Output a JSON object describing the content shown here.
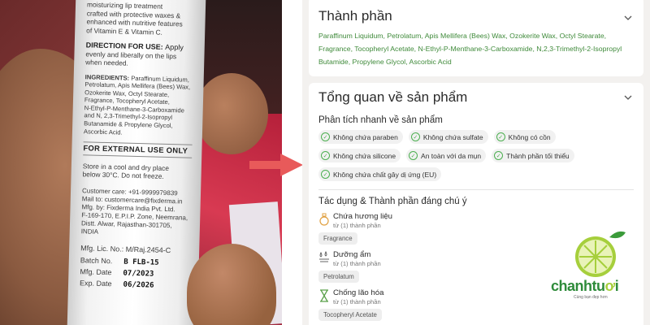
{
  "photo": {
    "intro_lines": [
      "moisturizing lip treatment",
      "crafted with protective waxes &",
      "enhanced with nutritive features",
      "of Vitamin E & Vitamin C."
    ],
    "direction_heading": "DIRECTION FOR USE:",
    "direction_lines": [
      "Apply",
      "evenly and liberally on the lips",
      "when needed."
    ],
    "ingredients_heading": "INGREDIENTS:",
    "ingredients_lines": [
      "Paraffinum Liquidum,",
      "Petrolatum, Apis Mellifera (Bees) Wax,",
      "Ozokerite Wax, Octyl Stearate,",
      "Fragrance, Tocopheryl Acetate,",
      "N-Ethyl-P-Menthane-3-Carboxamide",
      "and N, 2,3-Trimethyl-2-Isopropyl",
      "Butanamide & Propylene Glycol,",
      "Ascorbic Acid."
    ],
    "external_use": "FOR EXTERNAL USE ONLY",
    "store_lines": [
      "Store in a cool and dry place",
      "below 30°C. Do not freeze."
    ],
    "care_lines": [
      "Customer care: +91-9999979839",
      "Mail to: customercare@fixderma.in",
      "Mfg. by: Fixderma India Pvt. Ltd.",
      "F-169-170, E.P.I.P. Zone, Neemrana,",
      "Distt. Alwar, Rajasthan-301705,",
      "INDIA"
    ],
    "license": "Mfg. Lic. No.: M/Raj.2454-C",
    "batch_label": "Batch No.",
    "batch_value": "B FLB-15",
    "mfg_label": "Mfg. Date",
    "mfg_value": "07/2023",
    "exp_label": "Exp. Date",
    "exp_value": "06/2026"
  },
  "ingredients_card": {
    "title": "Thành phần",
    "text": "Paraffinum Liquidum, Petrolatum, Apis Mellifera (Bees) Wax, Ozokerite Wax, Octyl Stearate, Fragrance, Tocopheryl Acetate, N-Ethyl-P-Menthane-3-Carboxamide, N,2,3-Trimethyl-2-Isopropyl Butamide, Propylene Glycol, Ascorbic Acid"
  },
  "overview_card": {
    "title": "Tổng quan về sản phẩm",
    "quick_heading": "Phân tích nhanh về sản phẩm",
    "badges": [
      "Không chứa paraben",
      "Không chứa sulfate",
      "Không có cồn",
      "Không chứa silicone",
      "An toàn với da mụn",
      "Thành phần tối thiểu",
      "Không chứa chất gây dị ứng (EU)"
    ],
    "effects_heading": "Tác dụng & Thành phần đáng chú ý",
    "effects": [
      {
        "name": "Chứa hương liệu",
        "count": "từ (1) thành phần",
        "tag": "Fragrance",
        "icon": "perfume-icon"
      },
      {
        "name": "Dưỡng ẩm",
        "count": "từ (1) thành phần",
        "tag": "Petrolatum",
        "icon": "moisture-drops-icon"
      },
      {
        "name": "Chống lão hóa",
        "count": "từ (1) thành phần",
        "tag": "Tocopheryl Acetate",
        "icon": "hourglass-icon"
      }
    ]
  },
  "logo": {
    "brand_prefix": "chanhtu",
    "brand_suffix": "i",
    "tagline": "Cùng bạn đẹp hơn"
  },
  "colors": {
    "green_text": "#3f8a3a",
    "check_green": "#4caf50",
    "arrow_red": "#e85a5a",
    "panel_bg": "#f3f1ef"
  }
}
